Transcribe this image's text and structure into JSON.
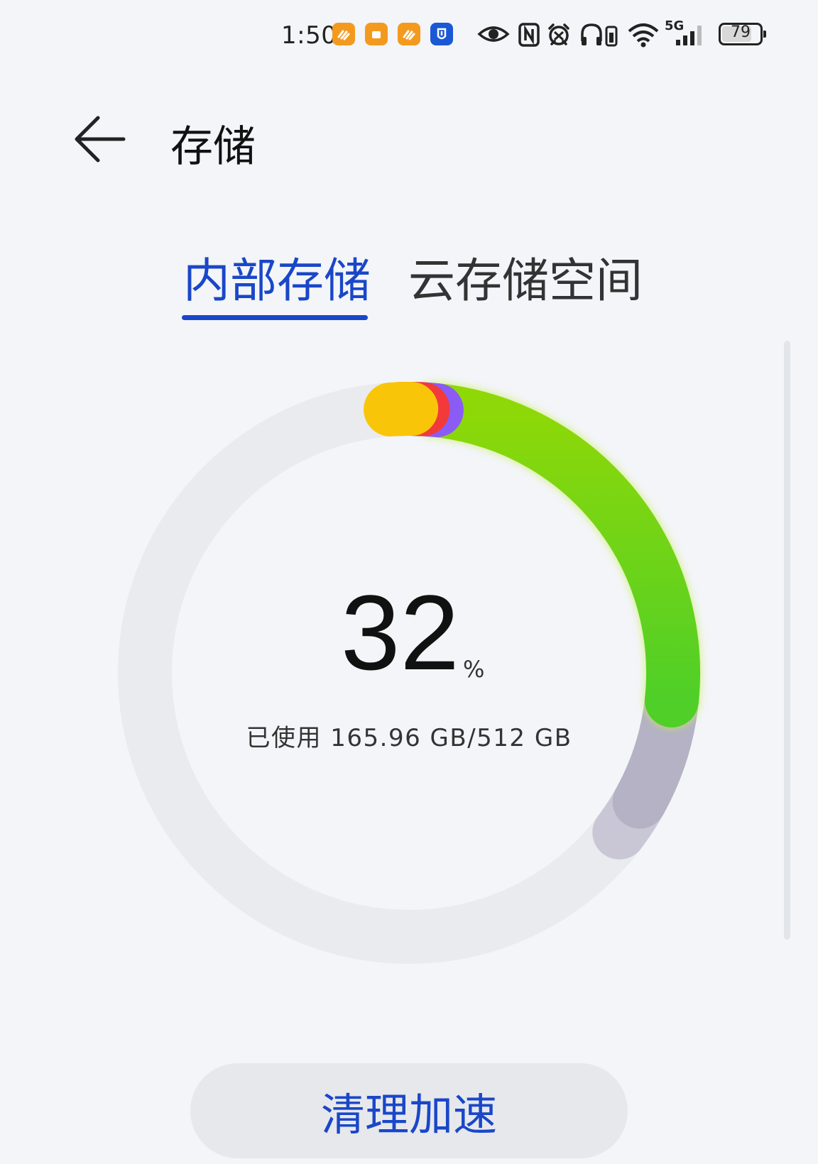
{
  "status_bar": {
    "time": "1:50",
    "network": "5G",
    "battery": "79",
    "notifications": [
      {
        "icon": "orange-app-icon",
        "color": "#f39a1e"
      },
      {
        "icon": "orange-square-app-icon",
        "color": "#f39a1e"
      },
      {
        "icon": "orange-app-icon",
        "color": "#f39a1e"
      },
      {
        "icon": "blue-app-icon",
        "color": "#1a58d6"
      }
    ],
    "system_icons": [
      "eye-icon",
      "nfc-icon",
      "alarm-icon",
      "headphones-icon",
      "wifi-icon",
      "signal-icon",
      "battery-icon"
    ]
  },
  "header": {
    "title": "存储",
    "back_icon": "arrow-left-icon"
  },
  "tabs": [
    {
      "label": "内部存储",
      "active": true
    },
    {
      "label": "云存储空间",
      "active": false
    }
  ],
  "usage": {
    "percent": "32",
    "percent_sign": "%",
    "label": "已使用 165.96 GB/512 GB",
    "percent_value": 32
  },
  "colors": {
    "accent": "#1a47c8",
    "ring_track": "#e9ebee",
    "segment_green": "#5fd21e",
    "segment_yellow": "#f9c508",
    "segment_red": "#f23a3a",
    "segment_purple": "#8a5cf5",
    "segment_gray": "#b7b5c8"
  },
  "actions": {
    "clean_label": "清理加速"
  }
}
